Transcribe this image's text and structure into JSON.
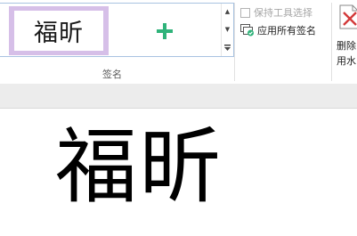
{
  "ribbon": {
    "signature_gallery": {
      "items": [
        {
          "preview_text": "福昕"
        }
      ],
      "add_icon": "plus-icon",
      "scroll": {
        "up_icon": "triangle-up-icon",
        "down_icon": "triangle-down-icon",
        "more_icon": "more-icon"
      }
    },
    "group_label": "签名",
    "options": {
      "keep_tool_selected": {
        "label": "保持工具选择",
        "checked": false,
        "enabled": false
      },
      "apply_all_signatures": {
        "label": "应用所有签名",
        "icon": "apply-signatures-icon"
      }
    },
    "delete_watermark": {
      "label_line1": "删除",
      "label_line2": "用水",
      "icon": "delete-watermark-icon"
    }
  },
  "document": {
    "signature_text": "福昕"
  },
  "colors": {
    "selected_item_bg": "#d6bfe8",
    "add_icon": "#2fb37a",
    "gallery_border": "#a9c3e1"
  }
}
